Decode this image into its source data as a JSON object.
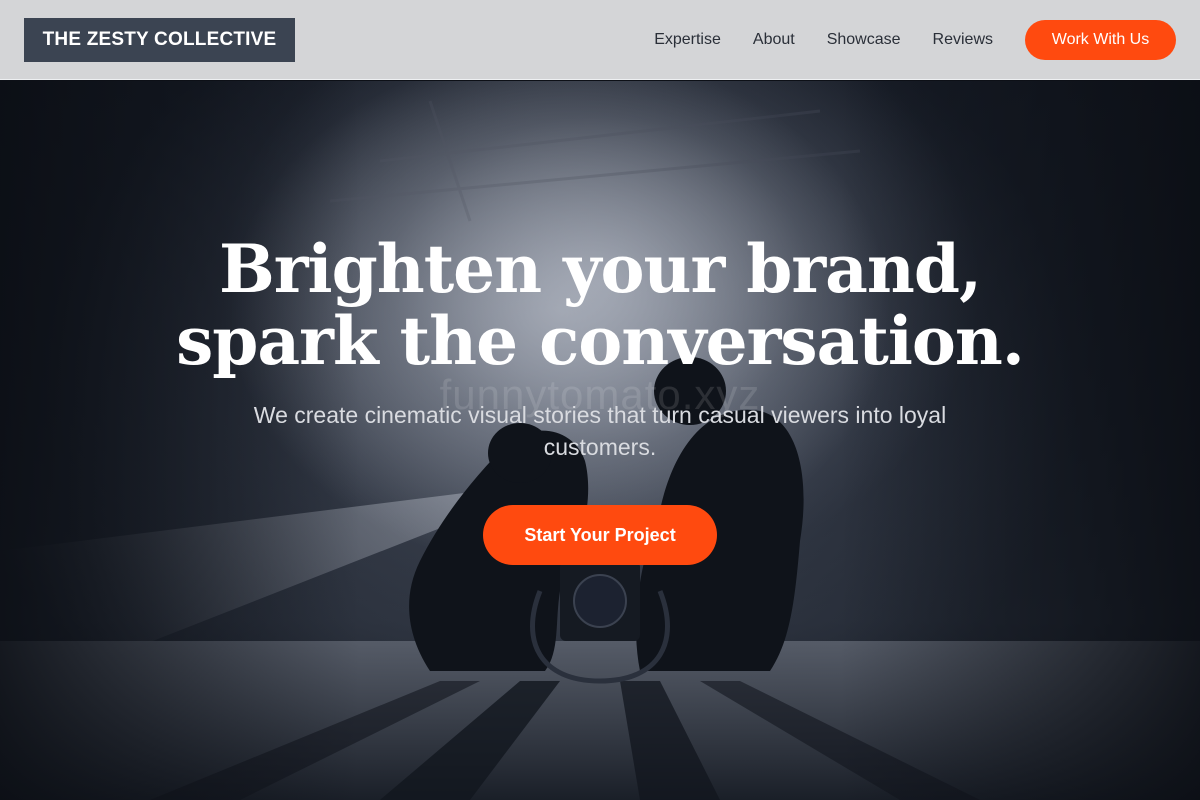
{
  "nav": {
    "logo": "THE ZESTY COLLECTIVE",
    "links": [
      "Expertise",
      "About",
      "Showcase",
      "Reviews"
    ],
    "cta": "Work With Us"
  },
  "hero": {
    "title_line1": "Brighten your brand,",
    "title_line2": "spark the conversation.",
    "watermark": "funnytomato.xyz",
    "subtitle": "We create cinematic visual stories that turn casual viewers into loyal customers.",
    "button": "Start Your Project",
    "image": "silhouettes of two crouching filmmakers with a camera rig, backlit by studio haze"
  },
  "colors": {
    "accent": "#ff4a0f",
    "logo_bg": "#3b4452",
    "nav_bg": "#d4d5d7",
    "hero_bg": "#161b25"
  }
}
